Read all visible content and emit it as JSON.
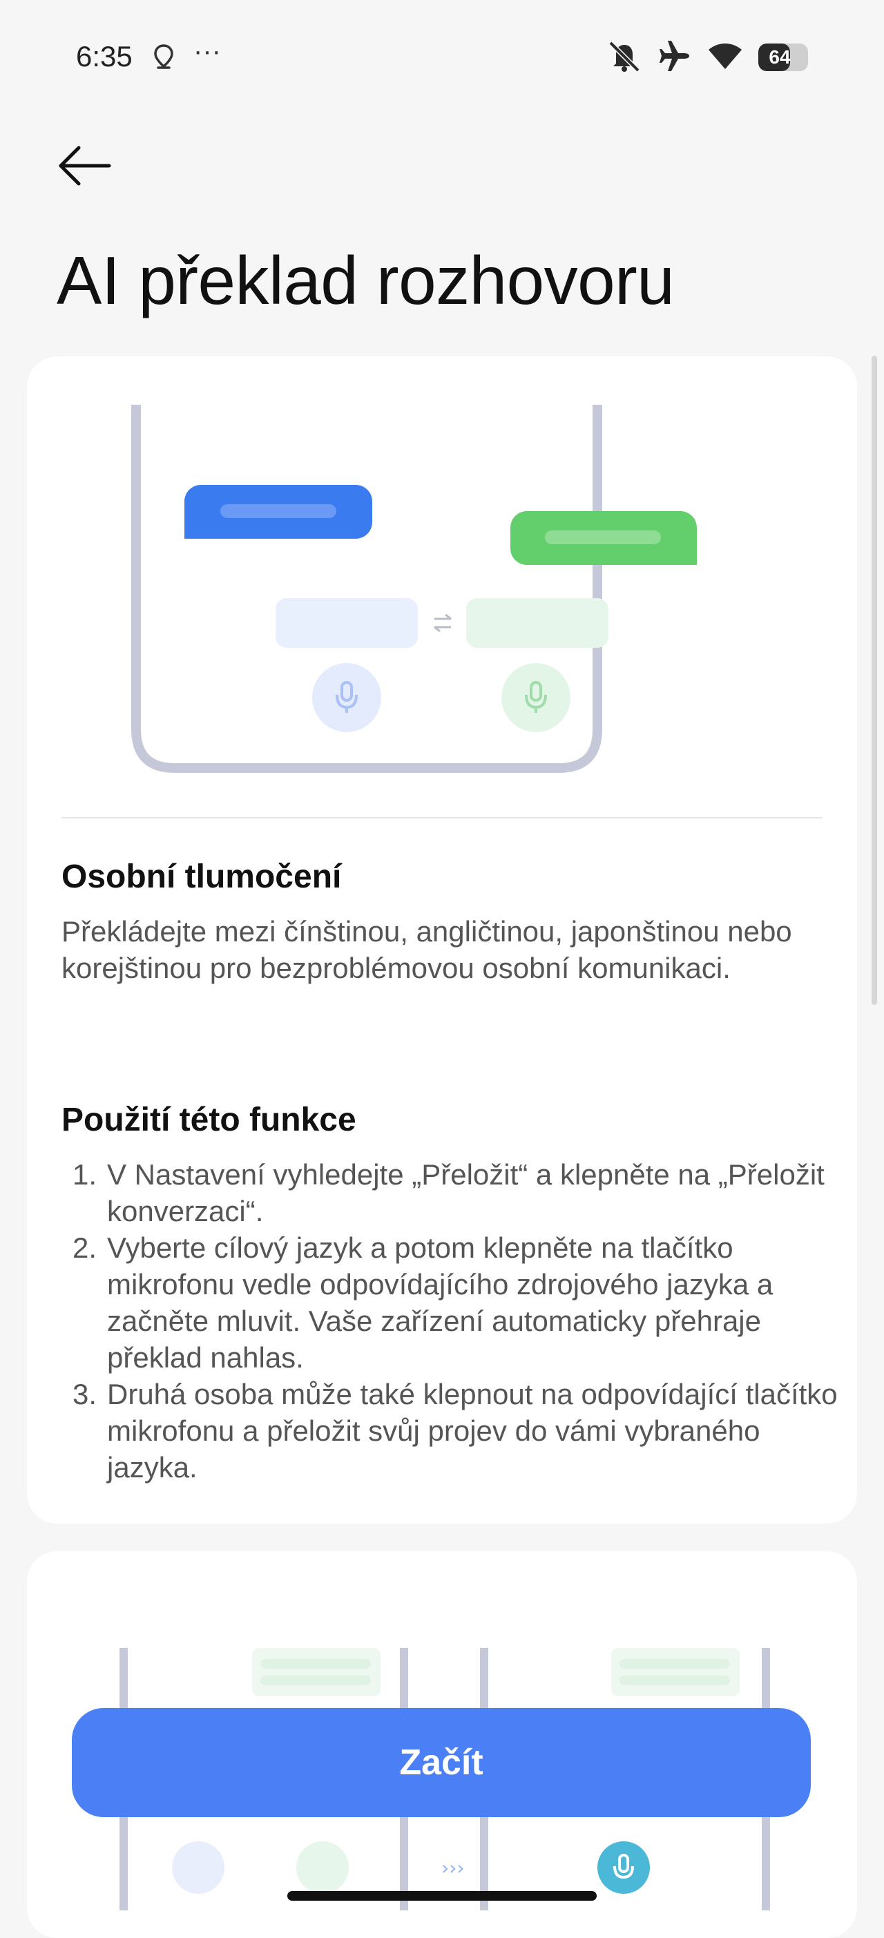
{
  "status_bar": {
    "time": "6:35",
    "more": "···",
    "battery_level": "64",
    "icons": [
      "location-icon",
      "bell-muted-icon",
      "airplane-mode-icon",
      "wifi-icon",
      "battery-icon"
    ]
  },
  "header": {
    "back_icon": "arrow-left-icon",
    "title": "AI překlad rozhovoru"
  },
  "sections": {
    "personal": {
      "title": "Osobní tlumočení",
      "description": "Překládejte mezi čínštinou, angličtinou, japonštinou nebo korejštinou pro bezproblémovou osobní komunikaci."
    },
    "usage": {
      "title": "Použití této funkce",
      "steps": [
        {
          "number": "1.",
          "text": "V Nastavení vyhledejte „Přeložit“ a klepněte na „Přeložit konverzaci“."
        },
        {
          "number": "2.",
          "text": "Vyberte cílový jazyk a potom klepněte na tlačítko mikrofonu vedle odpovídajícího zdrojového jazyka a začněte mluvit.  Vaše zařízení automaticky přehraje překlad nahlas."
        },
        {
          "number": "3.",
          "text": "Druhá osoba může také klepnout na odpovídající tlačítko mikrofonu a přeložit svůj projev do vámi vybraného jazyka."
        }
      ]
    }
  },
  "footer": {
    "start_label": "Začít"
  },
  "colors": {
    "accent": "#4b7ff5",
    "bubble_blue": "#3b7bf0",
    "bubble_green": "#63cf6c",
    "background": "#f6f6f6"
  }
}
